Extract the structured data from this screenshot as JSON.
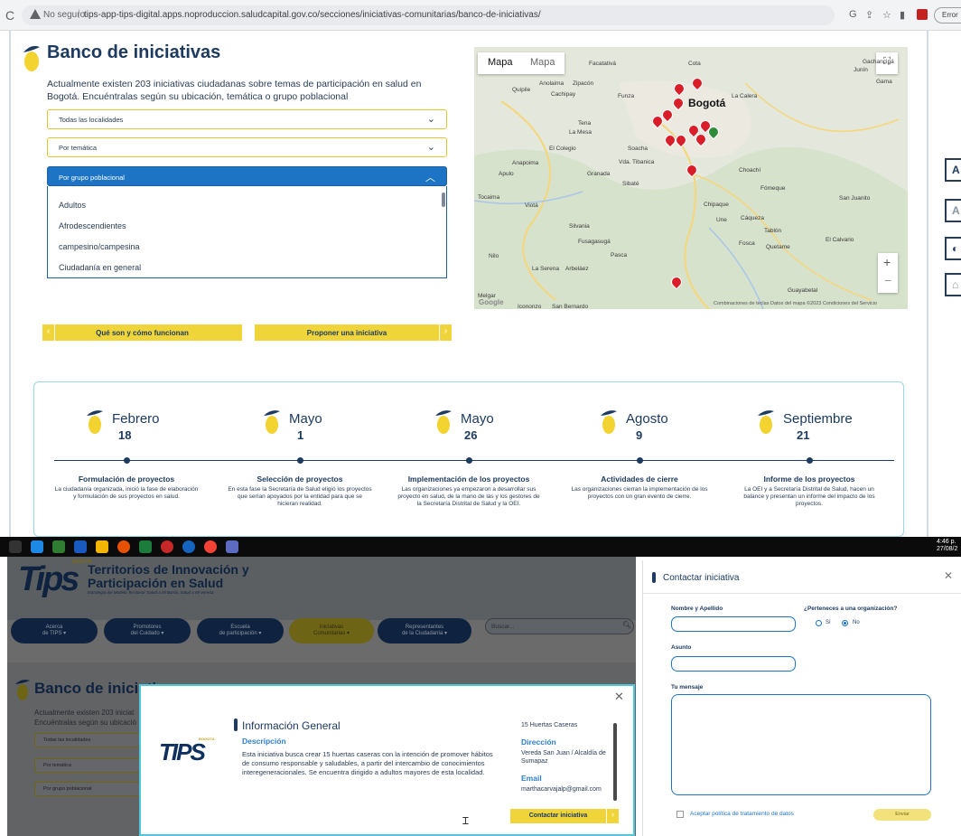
{
  "browser": {
    "not_secure": "No seguro",
    "url": "tips-app-tips-digital.apps.noproduccion.saludcapital.gov.co/secciones/iniciativas-comunitarias/banco-de-iniciativas/",
    "error": "Error"
  },
  "page": {
    "title": "Banco de iniciativas",
    "intro": "Actualmente existen 203 iniciativas ciudadanas sobre temas de participación en salud en Bogotá. Encuéntralas según su ubicación, temática o grupo poblacional",
    "filters": {
      "localidades": "Todas las localidades",
      "tematica": "Por temática",
      "grupo": "Por grupo poblacional",
      "grupo_options": [
        "Adultos",
        "Afrodescendientes",
        "campesino/campesina",
        "Ciudadanía en general"
      ]
    },
    "buttons": {
      "que_son": "Qué son y cómo funcionan",
      "proponer": "Proponer una iniciativa"
    }
  },
  "map": {
    "tab_map": "Mapa",
    "tab_satellite": "Mapa",
    "city": "Bogotá",
    "attribution": "Combinaciones de teclas   Datos del mapa ©2023   Condiciones del Servicio",
    "places": [
      "Facatativá",
      "Cota",
      "Gachancipá",
      "Anolaima",
      "Zipacón",
      "Quipile",
      "Cachipay",
      "Funza",
      "La Calera",
      "Tena",
      "La Mesa",
      "El Colegio",
      "Soacha",
      "Anapoima",
      "Granada",
      "Sibaté",
      "Apulo",
      "Chipaque",
      "Choachí",
      "Fómeque",
      "Viotá",
      "Une",
      "Cáqueza",
      "Silvania",
      "Fusagasugá",
      "Pasca",
      "Nilo",
      "Tabio",
      "Fosca",
      "Quetame",
      "La Serena",
      "Arbeláez",
      "El Calvario",
      "San Juanito",
      "Guayabetal",
      "Melgar",
      "Icononzo",
      "San Bernardo",
      "Tocaima",
      "Junín",
      "Gama",
      "Vda. Tibanica",
      "Tablón"
    ]
  },
  "timeline": [
    {
      "month": "Febrero",
      "day": "18",
      "title": "Formulación de proyectos",
      "desc": "La ciudadanía organizada, inició la fase de elaboración y formulación de sus proyectos en salud."
    },
    {
      "month": "Mayo",
      "day": "1",
      "title": "Selección de proyectos",
      "desc": "En esta fase la Secretaría de Salud eligió los proyectos que serían apoyados por la entidad para que se hicieran realidad."
    },
    {
      "month": "Mayo",
      "day": "26",
      "title": "Implementación de los proyectos",
      "desc": "Las organizaciones ya empezaron a desarrollar sus proyecto en salud, de la mano de las y los gestores de la Secretaría Distrital de Salud y la OEI."
    },
    {
      "month": "Agosto",
      "day": "9",
      "title": "Actividades de cierre",
      "desc": "Las organizaciones cierran la implementación de los proyectos con un gran evento de cierre."
    },
    {
      "month": "Septiembre",
      "day": "21",
      "title": "Informe de los proyectos",
      "desc": "La OEI y a Secretaría Distrital de Salud, hacen un balance y presentan un informe del impacto de los proyectos."
    }
  ],
  "side_icons": [
    "A",
    "A",
    "◐",
    "⌂"
  ],
  "taskbar": {
    "time": "4:46 p.",
    "date": "27/08/2"
  },
  "lower": {
    "bogota": "BOGOTÁ",
    "brand": "Territorios de Innovación y Participación en Salud",
    "tagline": "Estrategia del Modelo Territorial 'Salud a Mi Barrio, Salud a Mi Vereda'",
    "nav": [
      {
        "line1": "Acerca",
        "line2": "de TIPS ▾"
      },
      {
        "line1": "Promotores",
        "line2": "del Cuidado ▾"
      },
      {
        "line1": "Escuela",
        "line2": "de participación ▾"
      },
      {
        "line1": "Iniciativas",
        "line2": "Comunitarias ▾"
      },
      {
        "line1": "Representantes",
        "line2": "de la Ciudadanía ▾"
      }
    ],
    "search_placeholder": "Buscar...",
    "title": "Banco de iniciativas",
    "intro1": "Actualmente existen 203 iniciat",
    "intro2": "Encuéntralas según su ubicació",
    "filters": [
      "Todas las localidades",
      "Por temática",
      "Por grupo poblacional"
    ]
  },
  "info_modal": {
    "logo_bogota": "BOGOTÁ",
    "logo_text": "TIPS",
    "title": "Información General",
    "desc_label": "Descripción",
    "desc": "Esta iniciativa busca crear 15 huertas caseras con la intención de promover hábitos de consumo responsable y saludables, a partir del intercambio de conocimientos interegeneracionales. Se encuentra dirigido a adultos mayores de esta localidad.",
    "name": "15 Huertas Caseras",
    "dir_label": "Dirección",
    "dir": "Vereda San Juan / Alcaldía de Sumapaz",
    "email_label": "Email",
    "email": "marthacarvajalp@gmail.com",
    "contact_btn": "Contactar iniciativa"
  },
  "contact_modal": {
    "title": "Contactar iniciativa",
    "name_label": "Nombre y Apellido",
    "org_label": "¿Perteneces a una organización?",
    "yes": "Sí",
    "no": "No",
    "subject_label": "Asunto",
    "message_label": "Tu mensaje",
    "privacy": "Aceptar política de tratamiento de datos",
    "send": "Enviar"
  },
  "colors": {
    "brand_navy": "#1d3b60",
    "brand_yellow": "#f0d53a",
    "accent_blue": "#1e74c4",
    "pin_red": "#d91e2a"
  }
}
